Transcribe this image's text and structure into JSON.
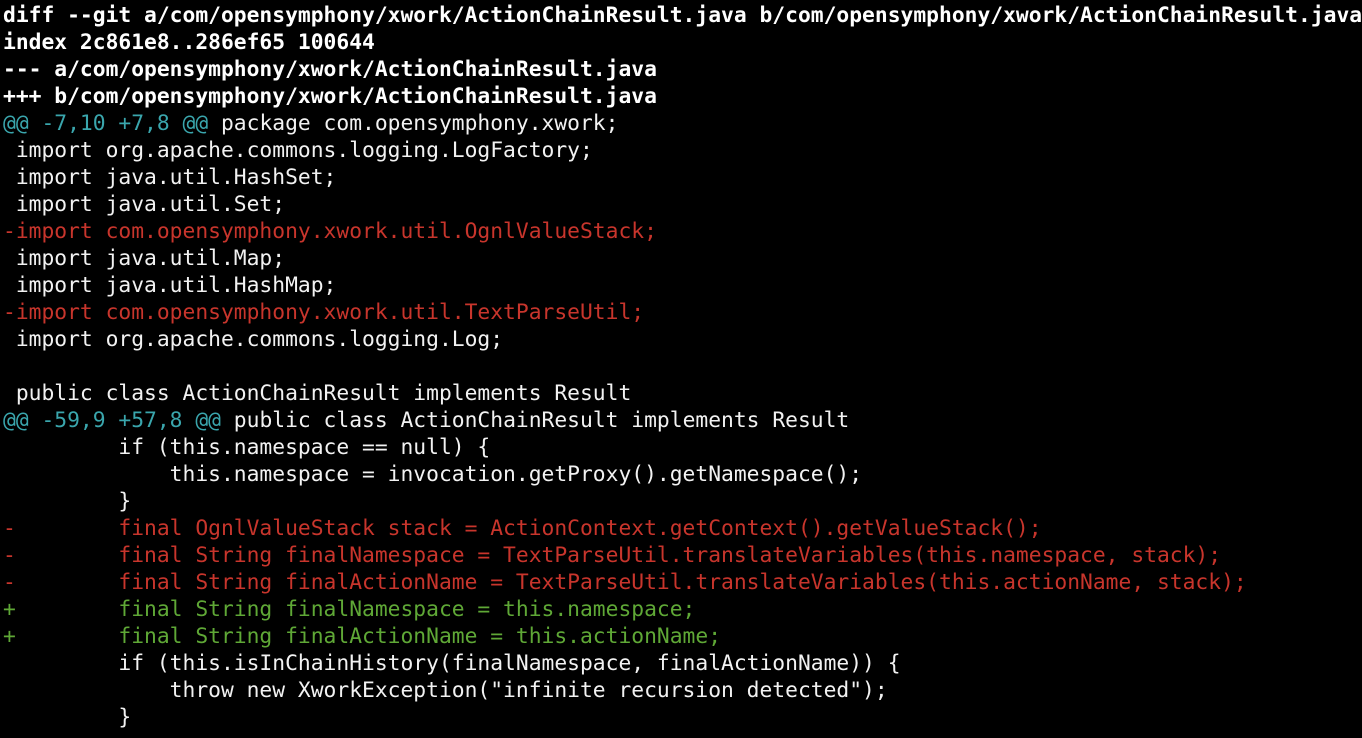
{
  "colors": {
    "background": "#000000",
    "text": "#f2f2f2",
    "hunk_marker": "#3aa6ad",
    "removed": "#c8352c",
    "added": "#5fa836"
  },
  "diff": {
    "header": {
      "diff_line": "diff --git a/com/opensymphony/xwork/ActionChainResult.java b/com/opensymphony/xwork/ActionChainResult.java",
      "index_line": "index 2c861e8..286ef65 100644",
      "old_file_line": "--- a/com/opensymphony/xwork/ActionChainResult.java",
      "new_file_line": "+++ b/com/opensymphony/xwork/ActionChainResult.java"
    },
    "hunk1": {
      "marker": "@@ -7,10 +7,8 @@",
      "context": " package com.opensymphony.xwork;",
      "lines": [
        " import org.apache.commons.logging.LogFactory;",
        " import java.util.HashSet;",
        " import java.util.Set;",
        "-import com.opensymphony.xwork.util.OgnlValueStack;",
        " import java.util.Map;",
        " import java.util.HashMap;",
        "-import com.opensymphony.xwork.util.TextParseUtil;",
        " import org.apache.commons.logging.Log;",
        "",
        " public class ActionChainResult implements Result"
      ]
    },
    "hunk2": {
      "marker": "@@ -59,9 +57,8 @@",
      "context": " public class ActionChainResult implements Result",
      "lines": [
        "         if (this.namespace == null) {",
        "             this.namespace = invocation.getProxy().getNamespace();",
        "         }",
        "-        final OgnlValueStack stack = ActionContext.getContext().getValueStack();",
        "-        final String finalNamespace = TextParseUtil.translateVariables(this.namespace, stack);",
        "-        final String finalActionName = TextParseUtil.translateVariables(this.actionName, stack);",
        "+        final String finalNamespace = this.namespace;",
        "+        final String finalActionName = this.actionName;",
        "         if (this.isInChainHistory(finalNamespace, finalActionName)) {",
        "             throw new XworkException(\"infinite recursion detected\");",
        "         }"
      ]
    }
  }
}
